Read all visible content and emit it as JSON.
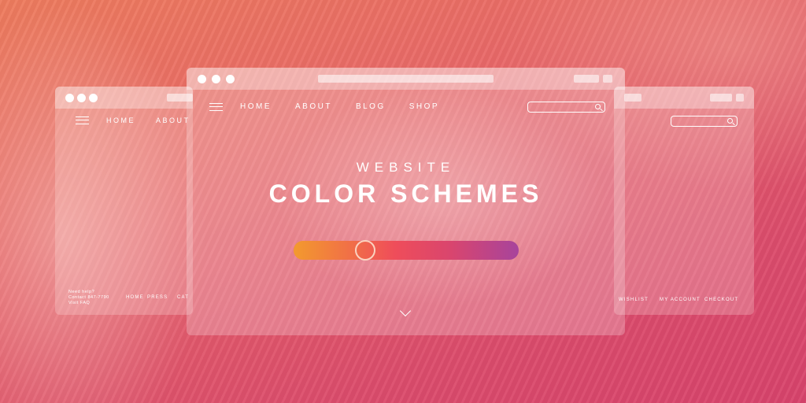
{
  "main_window": {
    "nav": [
      "HOME",
      "ABOUT",
      "BLOG",
      "SHOP"
    ],
    "search": {
      "placeholder": ""
    },
    "hero": {
      "eyebrow": "WEBSITE",
      "title": "COLOR SCHEMES"
    },
    "slider": {
      "value_percent": 30
    }
  },
  "left_window": {
    "nav": [
      "HOME",
      "ABOUT"
    ],
    "footer": {
      "contact_lines": [
        "Need help?",
        "Contact 847-7790",
        "Visit FAQ"
      ],
      "links": [
        "HOME",
        "PRESS",
        "CAT"
      ]
    }
  },
  "right_window": {
    "footer_links": [
      "WISHLIST",
      "MY ACCOUNT",
      "CHECKOUT"
    ]
  },
  "icons": {
    "menu": "hamburger-icon",
    "search": "search-icon",
    "scroll": "chevron-down-icon"
  },
  "colors": {
    "gradient_start": "#f39a2e",
    "gradient_mid": "#ef4d5a",
    "gradient_end": "#a7449c"
  }
}
